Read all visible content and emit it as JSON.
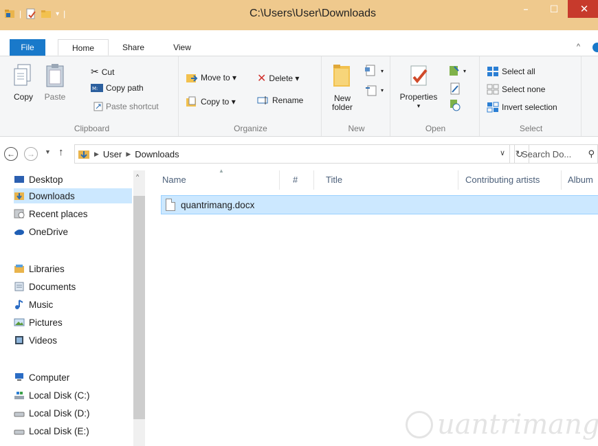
{
  "window": {
    "title": "C:\\Users\\User\\Downloads",
    "min_glyph": "–",
    "max_glyph": "☐",
    "close_glyph": "✕"
  },
  "tabs": {
    "file": "File",
    "home": "Home",
    "share": "Share",
    "view": "View",
    "collapse_glyph": "^"
  },
  "ribbon": {
    "clipboard": {
      "label": "Clipboard",
      "copy": "Copy",
      "paste": "Paste",
      "cut": "Cut",
      "copy_path": "Copy path",
      "paste_shortcut": "Paste shortcut"
    },
    "organize": {
      "label": "Organize",
      "move_to": "Move to ▾",
      "copy_to": "Copy to ▾",
      "delete": "Delete ▾",
      "rename": "Rename"
    },
    "new": {
      "label": "New",
      "new_folder_line1": "New",
      "new_folder_line2": "folder"
    },
    "open": {
      "label": "Open",
      "properties": "Properties",
      "properties_dd": "▾"
    },
    "select": {
      "label": "Select",
      "select_all": "Select all",
      "select_none": "Select none",
      "invert_selection": "Invert selection"
    }
  },
  "address": {
    "crumbs": [
      "User",
      "Downloads"
    ],
    "search_placeholder": "Search Do..."
  },
  "nav": {
    "items": [
      {
        "label": "Desktop",
        "icon": "desktop-icon"
      },
      {
        "label": "Downloads",
        "icon": "downloads-icon",
        "selected": true
      },
      {
        "label": "Recent places",
        "icon": "recent-places-icon"
      },
      {
        "label": "OneDrive",
        "icon": "onedrive-icon"
      },
      {
        "label": "Libraries",
        "icon": "libraries-icon"
      },
      {
        "label": "Documents",
        "icon": "documents-icon"
      },
      {
        "label": "Music",
        "icon": "music-icon"
      },
      {
        "label": "Pictures",
        "icon": "pictures-icon"
      },
      {
        "label": "Videos",
        "icon": "videos-icon"
      },
      {
        "label": "Computer",
        "icon": "computer-icon"
      },
      {
        "label": "Local Disk (C:)",
        "icon": "disk-icon"
      },
      {
        "label": "Local Disk (D:)",
        "icon": "disk-icon"
      },
      {
        "label": "Local Disk (E:)",
        "icon": "disk-icon"
      }
    ]
  },
  "columns": {
    "name": "Name",
    "number": "#",
    "title": "Title",
    "contributing_artists": "Contributing artists",
    "album": "Album"
  },
  "files": [
    {
      "name": "quantrimang.docx",
      "selected": true
    }
  ],
  "watermark": {
    "text": "uantrimang"
  },
  "colors": {
    "titlebar": "#efc98d",
    "file_tab": "#1979ca",
    "selection": "#cce8ff",
    "close": "#c73a2c"
  }
}
